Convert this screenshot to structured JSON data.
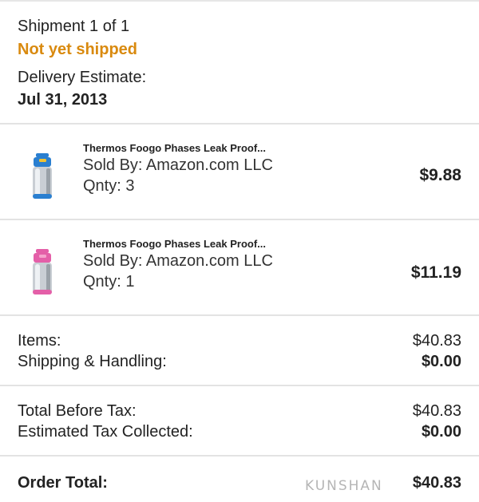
{
  "shipment": {
    "title": "Shipment 1 of 1",
    "status": "Not yet shipped",
    "delivery_label": "Delivery Estimate:",
    "delivery_date": "Jul 31, 2013"
  },
  "items": [
    {
      "name": "Thermos Foogo Phases Leak Proof...",
      "seller": "Sold By: Amazon.com LLC",
      "qty": "Qnty: 3",
      "price": "$9.88",
      "color": "#2a7fd0"
    },
    {
      "name": "Thermos Foogo Phases Leak Proof...",
      "seller": "Sold By: Amazon.com LLC",
      "qty": "Qnty: 1",
      "price": "$11.19",
      "color": "#e45fa8"
    }
  ],
  "summary": {
    "items_label": "Items:",
    "items_value": "$40.83",
    "shipping_label": "Shipping & Handling:",
    "shipping_value": "$0.00",
    "before_tax_label": "Total Before Tax:",
    "before_tax_value": "$40.83",
    "tax_label": "Estimated Tax Collected:",
    "tax_value": "$0.00",
    "order_total_label": "Order Total:",
    "order_total_value": "$40.83"
  },
  "watermark": {
    "text": "KUNSHAN"
  },
  "colors": {
    "status": "#d98a0f",
    "divider": "#e3e3e3"
  }
}
